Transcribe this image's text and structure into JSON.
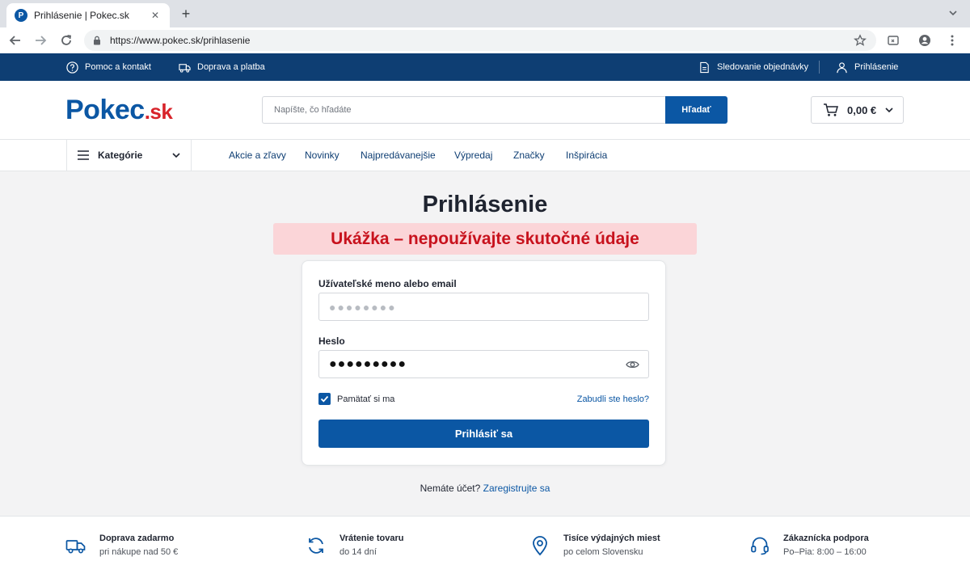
{
  "browser": {
    "tab_title": "Prihlásenie | Pokec.sk",
    "favicon_letter": "P",
    "url_host": "https://www.pokec.sk/prihlasenie"
  },
  "topbar": {
    "help": "Pomoc a kontakt",
    "shipping": "Doprava a platba",
    "tracking": "Sledovanie objednávky",
    "login": "Prihlásenie"
  },
  "header": {
    "logo_main": "Pokec",
    "logo_tld": ".sk",
    "search_placeholder": "Napíšte, čo hľadáte",
    "search_button": "Hľadať",
    "cart_total": "0,00 €"
  },
  "nav": {
    "categories": "Kategórie",
    "links": [
      "Akcie a zľavy",
      "Novinky",
      "Najpredávanejšie",
      "Výpredaj",
      "Značky",
      "Inšpirácia"
    ]
  },
  "login": {
    "title": "Prihlásenie",
    "demo_banner": "Ukážka – nepoužívajte skutočné údaje",
    "username_label": "Užívateľské meno alebo email",
    "username_value": "●●●●●●●●",
    "password_label": "Heslo",
    "password_value": "●●●●●●●●●",
    "remember": "Pamätať si ma",
    "remember_checked": true,
    "forgot": "Zabudli ste heslo?",
    "submit": "Prihlásiť sa",
    "no_account": "Nemáte účet?",
    "register": "Zaregistrujte sa"
  },
  "benefits": [
    {
      "icon": "truck-icon",
      "title": "Doprava zadarmo",
      "subtitle": "pri nákupe nad 50 €"
    },
    {
      "icon": "refresh-icon",
      "title": "Vrátenie tovaru",
      "subtitle": "do 14 dní"
    },
    {
      "icon": "map-pin-icon",
      "title": "Tisíce výdajných miest",
      "subtitle": "po celom Slovensku"
    },
    {
      "icon": "headset-icon",
      "title": "Zákaznícka podpora",
      "subtitle": "Po–Pia: 8:00 – 16:00"
    }
  ],
  "colors": {
    "brand_blue": "#0b57a4",
    "topbar_navy": "#0e3e73",
    "logo_red": "#d8232a",
    "banner_bg": "#fbd5d8",
    "banner_text": "#c8121d"
  }
}
